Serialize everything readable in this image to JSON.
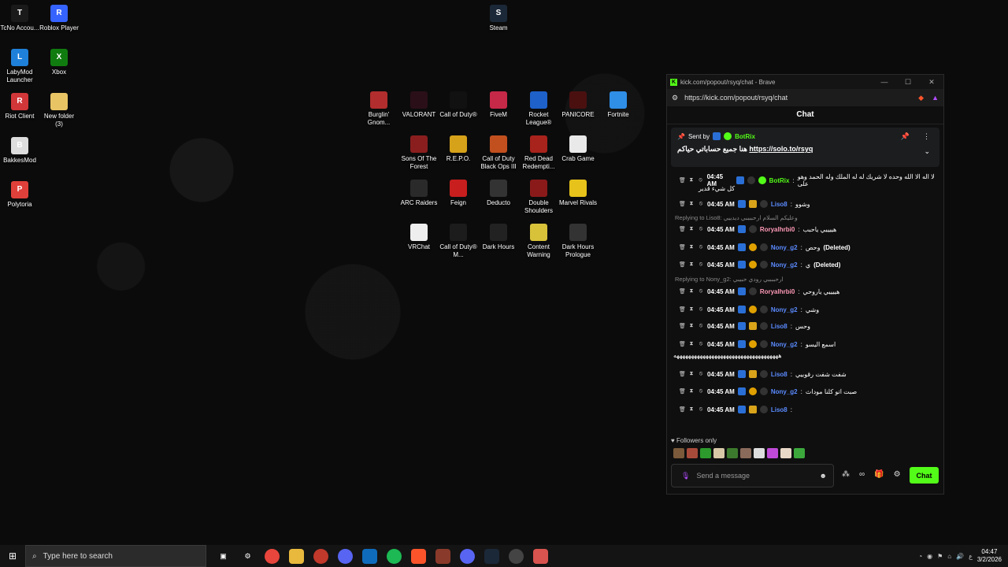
{
  "desktop": {
    "icons_left": [
      {
        "label": "TcNo Accou...",
        "color": "#1a1a1a",
        "glyph": "T"
      },
      {
        "label": "Roblox Player",
        "color": "#3563ff",
        "glyph": "R"
      },
      {
        "label": "LabyMod Launcher",
        "color": "#1f80d9",
        "glyph": "L"
      },
      {
        "label": "Xbox",
        "color": "#107c10",
        "glyph": "X"
      },
      {
        "label": "Riot Client",
        "color": "#d13639",
        "glyph": "R"
      },
      {
        "label": "New folder (3)",
        "color": "#e8c465",
        "glyph": ""
      },
      {
        "label": "BakkesMod",
        "color": "#ddd",
        "glyph": "B"
      },
      {
        "label": "Polytoria",
        "color": "#e0403a",
        "glyph": "P"
      }
    ],
    "steam_label": "Steam",
    "icons_grid": [
      {
        "label": "Burglin' Gnom...",
        "color": "#b22d2d"
      },
      {
        "label": "VALORANT",
        "color": "#2a0f18"
      },
      {
        "label": "Call of Duty®",
        "color": "#111"
      },
      {
        "label": "FiveM",
        "color": "#c62848"
      },
      {
        "label": "Rocket League®",
        "color": "#1e61c9"
      },
      {
        "label": "PANICORE",
        "color": "#4a1010"
      },
      {
        "label": "Fortnite",
        "color": "#2f8ee6"
      },
      {
        "label": "Sons Of The Forest",
        "color": "#8a1e1e"
      },
      {
        "label": "R.E.P.O.",
        "color": "#d6a21a"
      },
      {
        "label": "Call of Duty Black Ops III",
        "color": "#c2501f"
      },
      {
        "label": "Red Dead Redempti...",
        "color": "#a8231c"
      },
      {
        "label": "Crab Game",
        "color": "#e9e9e9"
      },
      {
        "label": "ARC Raiders",
        "color": "#2a2a2a"
      },
      {
        "label": "Feign",
        "color": "#c81e1e"
      },
      {
        "label": "Deducto",
        "color": "#333"
      },
      {
        "label": "Double Shoulders",
        "color": "#8a1a1a"
      },
      {
        "label": "Marvel Rivals",
        "color": "#e6c21a"
      },
      {
        "label": "VRChat",
        "color": "#eee"
      },
      {
        "label": "Call of Duty® M...",
        "color": "#1c1c1c"
      },
      {
        "label": "Dark Hours",
        "color": "#222"
      },
      {
        "label": "Content Warning",
        "color": "#d8c23a"
      },
      {
        "label": "Dark Hours Prologue",
        "color": "#333"
      }
    ]
  },
  "browser": {
    "title": "kick.com/popout/rsyq/chat - Brave",
    "url": "https://kick.com/popout/rsyq/chat",
    "chat_title": "Chat",
    "pinned": {
      "sent_by": "Sent by",
      "bot": "BotRix",
      "text": "هنا جميع حساباتي حياكم",
      "link": "https://solo.to/rsyq"
    },
    "messages": [
      {
        "time": "04:45 AM",
        "user": "BotRix",
        "user_color": "#53fc18",
        "text": "لا اله الا الله وحده لا شريك له له الملك وله الحمد وهو على",
        "text2": "كل شيء قدير",
        "badges": [
          "blue",
          "moon",
          "green"
        ]
      },
      {
        "time": "04:45 AM",
        "user": "Liso8",
        "user_color": "#5b8bff",
        "text": "وشوو",
        "badges": [
          "blue",
          "crown",
          "moon"
        ]
      },
      {
        "reply": "Replying to Liso8: وعليكم السلام ارحببببي ديدييي"
      },
      {
        "time": "04:45 AM",
        "user": "Roryalhrbi0",
        "user_color": "#ff9ab8",
        "text": "هييييي ياحبب",
        "badges": [
          "blue",
          "moon"
        ]
      },
      {
        "time": "04:45 AM",
        "user": "Nony_g2",
        "user_color": "#5b8bff",
        "text": "وحص",
        "deleted": "(Deleted)",
        "badges": [
          "blue",
          "gold",
          "moon"
        ]
      },
      {
        "time": "04:45 AM",
        "user": "Nony_g2",
        "user_color": "#5b8bff",
        "text": "ي",
        "deleted": "(Deleted)",
        "badges": [
          "blue",
          "gold",
          "moon"
        ]
      },
      {
        "reply": "Replying to Nony_g2: ارحببببي رودي حبيبي"
      },
      {
        "time": "04:45 AM",
        "user": "Roryalhrbi0",
        "user_color": "#ff9ab8",
        "text": "هييييي ياروحي",
        "badges": [
          "blue",
          "moon"
        ]
      },
      {
        "time": "04:45 AM",
        "user": "Nony_g2",
        "user_color": "#5b8bff",
        "text": "وشي",
        "badges": [
          "blue",
          "gold",
          "moon"
        ]
      },
      {
        "time": "04:45 AM",
        "user": "Liso8",
        "user_color": "#5b8bff",
        "text": "وحس",
        "badges": [
          "blue",
          "crown",
          "moon"
        ]
      },
      {
        "time": "04:45 AM",
        "user": "Nony_g2",
        "user_color": "#5b8bff",
        "text": "اسمع اليسو",
        "text2": "ههههههههههههههههههههههههههههههههههههه",
        "badges": [
          "blue",
          "gold",
          "moon"
        ]
      },
      {
        "time": "04:45 AM",
        "user": "Liso8",
        "user_color": "#5b8bff",
        "text": "شفت شفت رقوبيي",
        "badges": [
          "blue",
          "crown",
          "moon"
        ]
      },
      {
        "time": "04:45 AM",
        "user": "Nony_g2",
        "user_color": "#5b8bff",
        "text": "صبت اتو كلنا موداث",
        "badges": [
          "blue",
          "gold",
          "moon"
        ]
      },
      {
        "time": "04:45 AM",
        "user": "Liso8",
        "user_color": "#5b8bff",
        "text": "",
        "badges": [
          "blue",
          "crown",
          "moon"
        ]
      }
    ],
    "followers_only": "Followers only",
    "input_placeholder": "Send a message",
    "chat_button": "Chat"
  },
  "taskbar": {
    "search_placeholder": "Type here to search",
    "time": "04:47",
    "date": "3/2/2026",
    "lang": "ع"
  }
}
